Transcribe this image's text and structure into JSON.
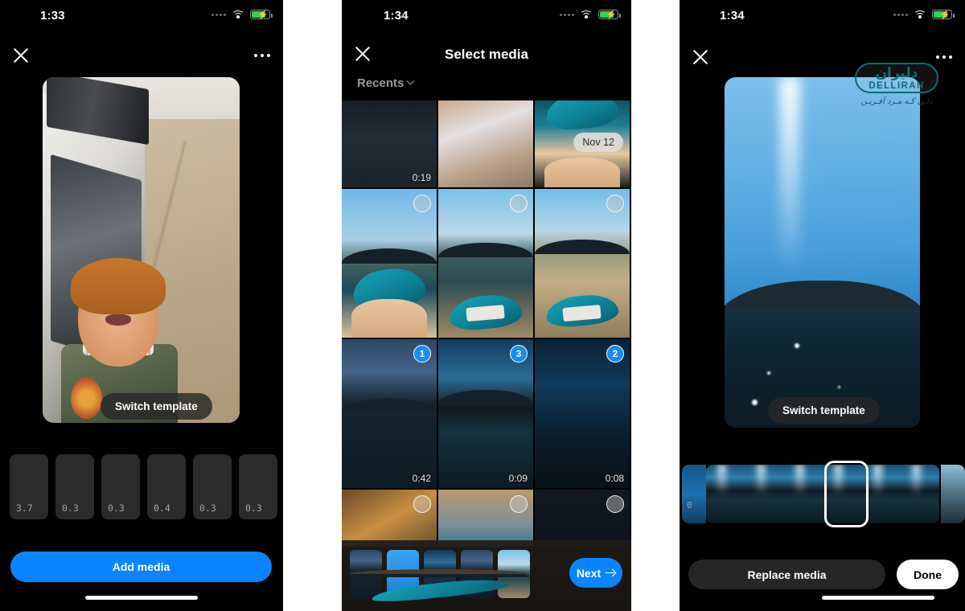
{
  "panels": {
    "editor": {
      "status": {
        "time": "1:33",
        "wifi_icon": "wifi-icon",
        "battery_icon": "battery-charging-icon"
      },
      "close_icon": "close-icon",
      "more_icon": "more-options-icon",
      "switch_template_label": "Switch template",
      "add_media_label": "Add media",
      "segments": [
        {
          "duration": "3.7"
        },
        {
          "duration": "0.3"
        },
        {
          "duration": "0.3"
        },
        {
          "duration": "0.4"
        },
        {
          "duration": "0.3"
        },
        {
          "duration": "0.3"
        }
      ]
    },
    "picker": {
      "status": {
        "time": "1:34",
        "wifi_icon": "wifi-icon",
        "battery_icon": "battery-charging-icon"
      },
      "close_icon": "close-icon",
      "title": "Select media",
      "album_label": "Recents",
      "album_chevron_icon": "chevron-down-icon",
      "date_chip": "Nov 12",
      "grid": [
        {
          "name": "lake-water-video",
          "duration": "0:19",
          "badge": "",
          "selected": false
        },
        {
          "name": "girl-portrait",
          "duration": "",
          "badge": "",
          "selected": false
        },
        {
          "name": "kayak-knees-top",
          "duration": "",
          "badge": "",
          "selected": false
        },
        {
          "name": "kayak-lake-knees",
          "duration": "",
          "badge": "",
          "selected": false
        },
        {
          "name": "kayak-shore-calm",
          "duration": "",
          "badge": "",
          "selected": false
        },
        {
          "name": "kayak-shore-wide",
          "duration": "",
          "badge": "",
          "selected": false
        },
        {
          "name": "lake-dusk-wide",
          "duration": "0:42",
          "badge": "1",
          "selected": true
        },
        {
          "name": "lake-sunbeam",
          "duration": "0:09",
          "badge": "3",
          "selected": true
        },
        {
          "name": "lake-night-dark",
          "duration": "0:08",
          "badge": "2",
          "selected": true
        },
        {
          "name": "campfire-food",
          "duration": "",
          "badge": "",
          "selected": false
        },
        {
          "name": "boat-ramp",
          "duration": "",
          "badge": "",
          "selected": false
        },
        {
          "name": "dark-scene",
          "duration": "",
          "badge": "",
          "selected": false
        }
      ],
      "tray_thumbs": [
        "selected-clip-1",
        "selected-clip-2",
        "selected-clip-3",
        "selected-clip-4",
        "selected-clip-5"
      ],
      "next_label": "Next",
      "next_arrow_icon": "arrow-right-icon"
    },
    "trimmer": {
      "status": {
        "time": "1:34",
        "wifi_icon": "wifi-icon",
        "battery_icon": "battery-charging-icon"
      },
      "close_icon": "close-icon",
      "more_icon": "more-options-icon",
      "switch_template_label": "Switch template",
      "replace_media_label": "Replace media",
      "done_label": "Done",
      "filmstrip_edge_value": "0",
      "watermark": {
        "script_text": "دلیران",
        "latin_text": "DELLIRAN",
        "tagline": "دلـی کـه مـرد آفـریـن"
      }
    }
  },
  "colors": {
    "accent_blue": "#0a85ff",
    "badge_blue": "#1a8cf0",
    "panel_black": "#000000",
    "segment_gray": "#2b2b2b",
    "watermark_teal": "#0c6b78"
  }
}
